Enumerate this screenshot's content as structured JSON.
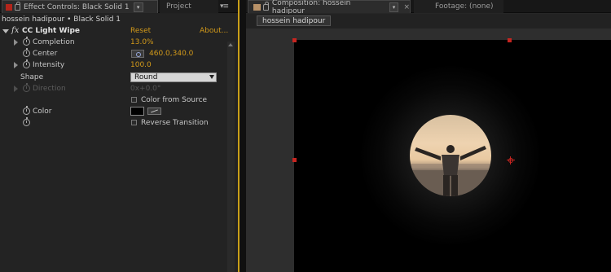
{
  "left_panel": {
    "tabs": [
      {
        "label": "Effect Controls: Black Solid 1",
        "active": true
      },
      {
        "label": "Project",
        "active": false
      }
    ],
    "menu_glyph": "▾≡",
    "dropdown_glyph": "▾",
    "layer_path": "hossein hadipour • Black Solid 1",
    "effect": {
      "fx_tag": "fx",
      "name": "CC Light Wipe",
      "reset_label": "Reset",
      "about_label": "About..."
    },
    "properties": {
      "completion": {
        "label": "Completion",
        "value": "13.0%"
      },
      "center": {
        "label": "Center",
        "value": "460.0,340.0"
      },
      "intensity": {
        "label": "Intensity",
        "value": "100.0"
      },
      "shape": {
        "label": "Shape",
        "value": "Round"
      },
      "direction": {
        "label": "Direction",
        "value": "0x+0.0°"
      },
      "color_from_source": {
        "label": "Color from Source",
        "checked": false
      },
      "color": {
        "label": "Color",
        "swatch": "#000000"
      },
      "reverse_transition": {
        "label": "Reverse Transition",
        "checked": false
      }
    }
  },
  "right_panel": {
    "tabs": [
      {
        "label": "Composition: hossein hadipour",
        "active": true
      },
      {
        "label": "Footage: (none)",
        "active": false
      }
    ],
    "close_glyph": "×",
    "dropdown_glyph": "▾",
    "breadcrumb": "hossein hadipour"
  },
  "colors": {
    "accent_orange": "#d39a1a",
    "panel_border_yellow": "#caa019",
    "handle_red": "#c72520"
  }
}
